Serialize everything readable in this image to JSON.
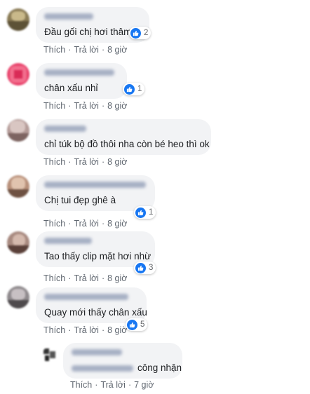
{
  "comments": [
    {
      "text": "Đầu gối chị hơi thâm",
      "likes": "2",
      "like": "Thích",
      "reply": "Trả lời",
      "time": "8 giờ"
    },
    {
      "text": "chân xấu nhỉ",
      "likes": "1",
      "like": "Thích",
      "reply": "Trả lời",
      "time": "8 giờ"
    },
    {
      "text": "chỉ túk bộ đồ thôi nha còn bé heo thì ok",
      "likes": "",
      "like": "Thích",
      "reply": "Trả lời",
      "time": "8 giờ"
    },
    {
      "text": "Chị tui đẹp ghê à",
      "likes": "1",
      "like": "Thích",
      "reply": "Trả lời",
      "time": "8 giờ"
    },
    {
      "text": "Tao thấy clip mặt hơi nhừ",
      "likes": "3",
      "like": "Thích",
      "reply": "Trả lời",
      "time": "8 giờ"
    },
    {
      "text": "Quay mới thấy chân xấu",
      "likes": "5",
      "like": "Thích",
      "reply": "Trả lời",
      "time": "8 giờ"
    }
  ],
  "reply": {
    "text": "công nhận",
    "like": "Thích",
    "reply": "Trả lời",
    "time": "7 giờ"
  },
  "colors": {
    "bubble": "#f2f3f5",
    "like_blue": "#1877f2",
    "meta": "#606770"
  }
}
